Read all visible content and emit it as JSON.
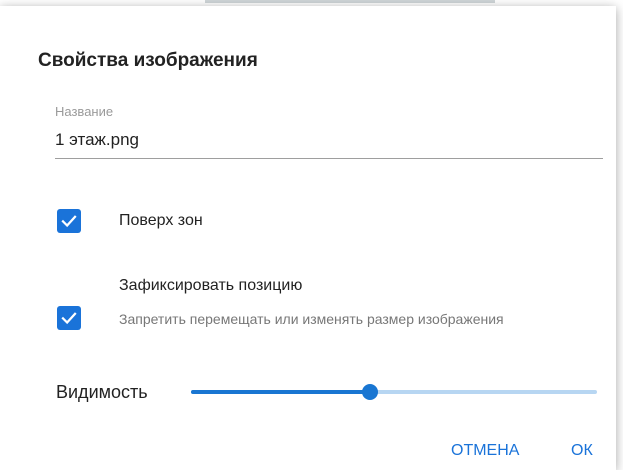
{
  "dialog": {
    "title": "Свойства изображения",
    "name_field": {
      "label": "Название",
      "value": "1 этаж.png"
    },
    "options": [
      {
        "label": "Поверх зон",
        "checked": true,
        "hint": ""
      },
      {
        "label": "Зафиксировать позицию",
        "checked": true,
        "hint": "Запретить перемещать или изменять размер изображения"
      }
    ],
    "visibility": {
      "label": "Видимость",
      "value_fraction": 0.44
    },
    "buttons": {
      "cancel_label": "ОТМЕНА",
      "ok_label": "ОК"
    },
    "colors": {
      "accent": "#1a73d9",
      "slider_rail": "#b7d6f2"
    },
    "icons": {
      "checkbox_checked": "check-icon"
    }
  }
}
